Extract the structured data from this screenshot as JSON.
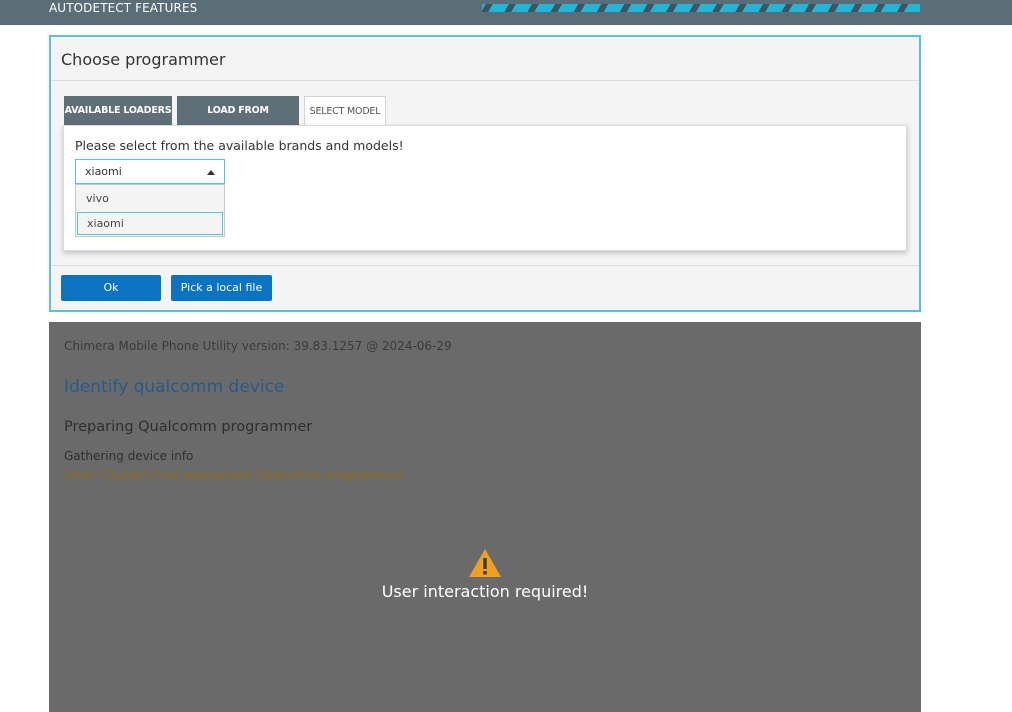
{
  "topbar": {
    "title": "AUTODETECT FEATURES"
  },
  "dialog": {
    "title": "Choose programmer",
    "tabs": [
      {
        "label": "AVAILABLE LOADERS",
        "active": false
      },
      {
        "label": "LOAD FROM DIRECTORY",
        "active": false
      },
      {
        "label": "SELECT MODEL",
        "active": true
      }
    ],
    "panel": {
      "label": "Please select from the available brands and models!",
      "select": {
        "value": "xiaomi",
        "options": [
          "vivo",
          "xiaomi"
        ]
      }
    },
    "buttons": {
      "ok": "Ok",
      "pick": "Pick a local file"
    }
  },
  "log": {
    "version": "Chimera Mobile Phone Utility version: 39.83.1257 @ 2024-06-29",
    "identify": "Identify qualcomm device",
    "preparing": "Preparing Qualcomm programmer",
    "gathering": "Gathering device info",
    "error": "Error! Couldn't find appropriate Qualcomm programmer!",
    "user_message": "User interaction required!"
  },
  "colors": {
    "accent": "#58c3d8",
    "button": "#0b74c2",
    "tab_inactive": "#5f6f78",
    "warning": "#f0a020",
    "error_text": "#8b6a1e"
  }
}
